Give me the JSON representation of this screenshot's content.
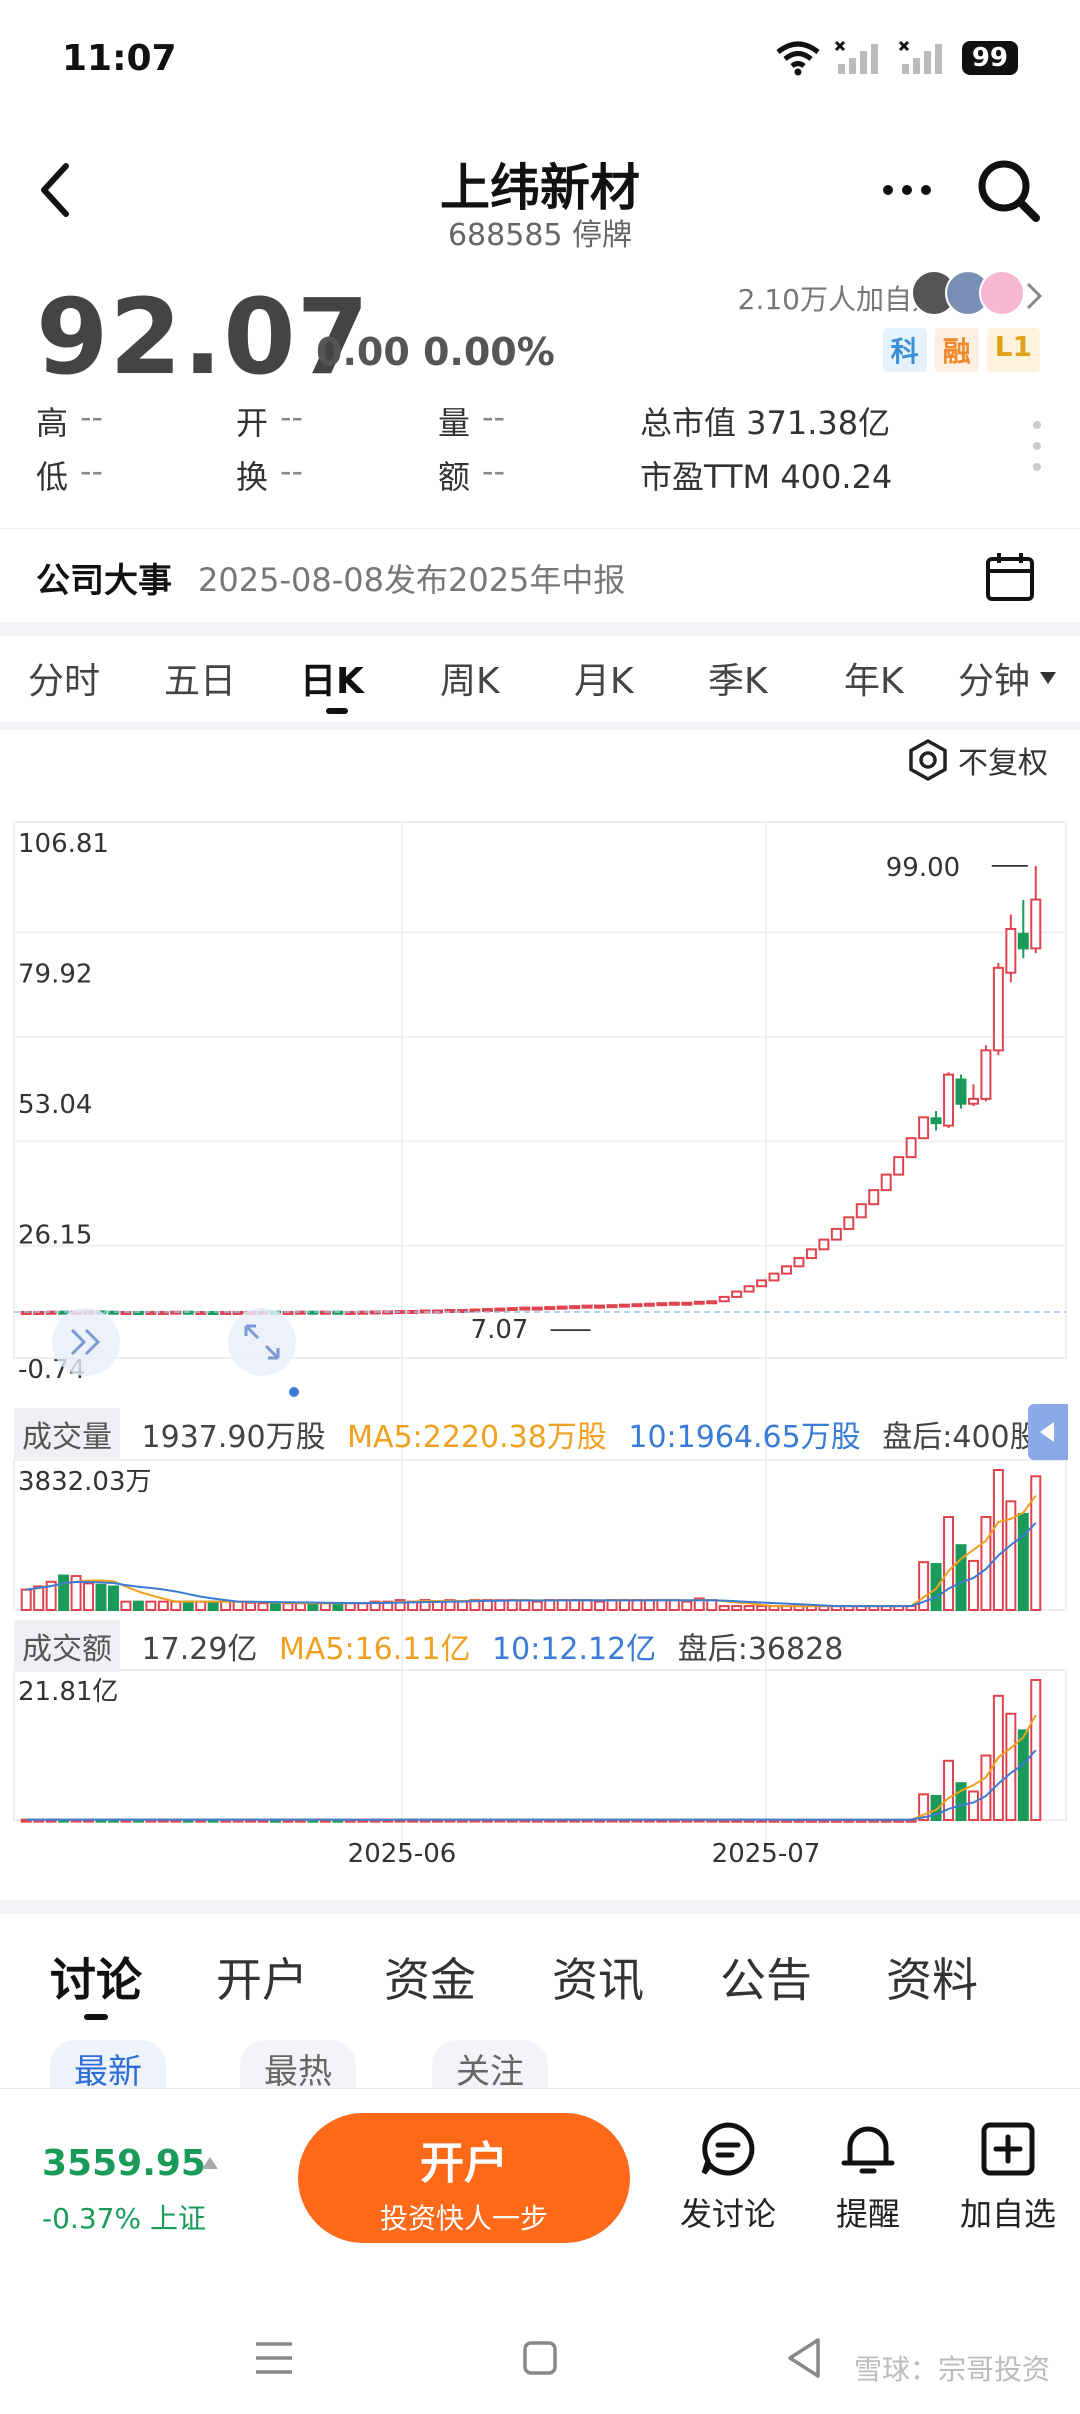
{
  "status_bar": {
    "time": "11:07",
    "battery": "99"
  },
  "header": {
    "title": "上纬新材",
    "subtitle": "688585 停牌"
  },
  "quote": {
    "price": "92.07",
    "change": "0.00 0.00%",
    "watchers": "2.10万人加自选",
    "badges": [
      "科",
      "融",
      "L1"
    ],
    "stats": {
      "high_label": "高",
      "high_value": "--",
      "low_label": "低",
      "low_value": "--",
      "open_label": "开",
      "open_value": "--",
      "turnover_label": "换",
      "turnover_value": "--",
      "volume_label": "量",
      "volume_value": "--",
      "amount_label": "额",
      "amount_value": "--",
      "mktcap": "总市值 371.38亿",
      "pe": "市盈TTM 400.24"
    }
  },
  "events": {
    "label": "公司大事",
    "text": "2025-08-08发布2025年中报"
  },
  "period_tabs": [
    "分时",
    "五日",
    "日K",
    "周K",
    "月K",
    "季K",
    "年K",
    "分钟"
  ],
  "adjust_label": "不复权",
  "chart_data": {
    "type": "candlestick",
    "y_ticks": [
      "106.81",
      "79.92",
      "53.04",
      "26.15",
      "-0.74"
    ],
    "ylim": [
      -0.74,
      106.81
    ],
    "x_ticks": [
      "2025-06",
      "2025-07"
    ],
    "max_label": "99.00",
    "min_label": "7.07",
    "candles": [
      [
        7.1,
        7.1,
        7.2,
        7.0
      ],
      [
        7.1,
        7.1,
        7.2,
        7.0
      ],
      [
        7.1,
        7.15,
        7.2,
        7.0
      ],
      [
        7.15,
        7.1,
        7.2,
        7.0
      ],
      [
        7.1,
        7.15,
        7.3,
        7.0
      ],
      [
        7.15,
        7.2,
        7.3,
        7.1
      ],
      [
        7.2,
        7.15,
        7.3,
        7.1
      ],
      [
        7.15,
        7.1,
        7.2,
        7.0
      ],
      [
        7.1,
        7.1,
        7.2,
        7.0
      ],
      [
        7.1,
        7.05,
        7.2,
        7.0
      ],
      [
        7.05,
        7.1,
        7.2,
        7.0
      ],
      [
        7.1,
        7.1,
        7.2,
        7.0
      ],
      [
        7.1,
        7.15,
        7.2,
        7.0
      ],
      [
        7.15,
        7.1,
        7.2,
        7.0
      ],
      [
        7.1,
        7.1,
        7.2,
        7.0
      ],
      [
        7.1,
        7.05,
        7.2,
        7.0
      ],
      [
        7.05,
        7.1,
        7.2,
        7.0
      ],
      [
        7.1,
        7.1,
        7.2,
        7.0
      ],
      [
        7.1,
        7.1,
        7.2,
        7.07
      ],
      [
        7.1,
        7.15,
        7.2,
        7.1
      ],
      [
        7.15,
        7.1,
        7.2,
        7.1
      ],
      [
        7.1,
        7.1,
        7.2,
        7.1
      ],
      [
        7.1,
        7.15,
        7.2,
        7.1
      ],
      [
        7.15,
        7.1,
        7.2,
        7.1
      ],
      [
        7.1,
        7.15,
        7.2,
        7.1
      ],
      [
        7.15,
        7.1,
        7.2,
        7.1
      ],
      [
        7.1,
        7.1,
        7.2,
        7.1
      ],
      [
        7.1,
        7.15,
        7.2,
        7.1
      ],
      [
        7.15,
        7.2,
        7.3,
        7.1
      ],
      [
        7.2,
        7.2,
        7.3,
        7.1
      ],
      [
        7.2,
        7.3,
        7.4,
        7.1
      ],
      [
        7.3,
        7.3,
        7.4,
        7.2
      ],
      [
        7.3,
        7.4,
        7.5,
        7.2
      ],
      [
        7.4,
        7.4,
        7.5,
        7.3
      ],
      [
        7.4,
        7.5,
        7.6,
        7.3
      ],
      [
        7.5,
        7.5,
        7.6,
        7.4
      ],
      [
        7.5,
        7.6,
        7.7,
        7.4
      ],
      [
        7.6,
        7.7,
        7.8,
        7.5
      ],
      [
        7.7,
        7.8,
        7.9,
        7.6
      ],
      [
        7.8,
        7.9,
        8.0,
        7.7
      ],
      [
        7.9,
        8.0,
        8.1,
        7.8
      ],
      [
        8.0,
        8.0,
        8.1,
        7.9
      ],
      [
        8.0,
        8.1,
        8.2,
        7.9
      ],
      [
        8.1,
        8.2,
        8.3,
        8.0
      ],
      [
        8.2,
        8.3,
        8.4,
        8.1
      ],
      [
        8.3,
        8.4,
        8.5,
        8.2
      ],
      [
        8.4,
        8.4,
        8.5,
        8.3
      ],
      [
        8.4,
        8.5,
        8.6,
        8.3
      ],
      [
        8.5,
        8.6,
        8.7,
        8.4
      ],
      [
        8.6,
        8.7,
        8.8,
        8.5
      ],
      [
        8.7,
        8.8,
        8.9,
        8.6
      ],
      [
        8.8,
        8.9,
        9.0,
        8.7
      ],
      [
        8.9,
        9.0,
        9.1,
        8.8
      ],
      [
        9.0,
        9.0,
        9.1,
        8.9
      ],
      [
        9.0,
        9.2,
        9.3,
        8.9
      ],
      [
        9.2,
        9.3,
        9.4,
        9.1
      ],
      [
        9.3,
        10.2,
        10.3,
        9.2
      ],
      [
        10.2,
        11.3,
        11.3,
        10.2
      ],
      [
        11.3,
        12.4,
        12.4,
        11.3
      ],
      [
        12.4,
        13.6,
        13.6,
        12.4
      ],
      [
        13.6,
        15.0,
        15.0,
        13.6
      ],
      [
        15.0,
        16.5,
        16.5,
        15.0
      ],
      [
        16.5,
        18.2,
        18.2,
        16.5
      ],
      [
        18.2,
        20.0,
        20.0,
        18.2
      ],
      [
        20.0,
        22.0,
        22.0,
        20.0
      ],
      [
        22.0,
        24.2,
        24.2,
        22.0
      ],
      [
        24.2,
        26.6,
        26.6,
        24.2
      ],
      [
        26.6,
        29.3,
        29.3,
        26.6
      ],
      [
        29.3,
        32.2,
        32.2,
        29.3
      ],
      [
        32.2,
        35.4,
        35.4,
        32.2
      ],
      [
        35.4,
        39.0,
        39.0,
        35.4
      ],
      [
        39.0,
        42.9,
        42.9,
        39.0
      ],
      [
        42.9,
        47.2,
        47.2,
        42.9
      ],
      [
        47.0,
        46.0,
        48.5,
        44.5
      ],
      [
        45.5,
        56.0,
        56.5,
        45.0
      ],
      [
        55.0,
        50.0,
        56.0,
        49.0
      ],
      [
        50.0,
        51.0,
        54.0,
        49.5
      ],
      [
        51.0,
        61.0,
        62.0,
        50.5
      ],
      [
        61.0,
        78.0,
        79.0,
        60.0
      ],
      [
        77.0,
        86.0,
        89.0,
        75.0
      ],
      [
        85.0,
        82.0,
        92.0,
        80.0
      ],
      [
        82.0,
        92.07,
        99.0,
        81.0
      ]
    ],
    "volume_max_label": "3832.03万",
    "amount_max_label": "21.81亿"
  },
  "volume_header": {
    "tag": "成交量",
    "value": "1937.90万股",
    "ma5": "MA5:2220.38万股",
    "ma10": "10:1964.65万股",
    "after": "盘后:400股"
  },
  "amount_header": {
    "tag": "成交额",
    "value": "17.29亿",
    "ma5": "MA5:16.11亿",
    "ma10": "10:12.12亿",
    "after": "盘后:36828"
  },
  "bottom_tabs": [
    "讨论",
    "开户",
    "资金",
    "资讯",
    "公告",
    "资料"
  ],
  "filters": [
    "最新",
    "最热",
    "关注"
  ],
  "footer": {
    "index_value": "3559.95",
    "index_change": "-0.37% 上证",
    "open_title": "开户",
    "open_sub": "投资快人一步",
    "discuss": "发讨论",
    "remind": "提醒",
    "add_watch": "加自选"
  },
  "watermark": "雪球：宗哥投资",
  "colors": {
    "up": "#e0434d",
    "down": "#1a9b5a",
    "ma5": "#f0a020",
    "ma10": "#3a7bd5",
    "accent": "#ff6a1a"
  }
}
